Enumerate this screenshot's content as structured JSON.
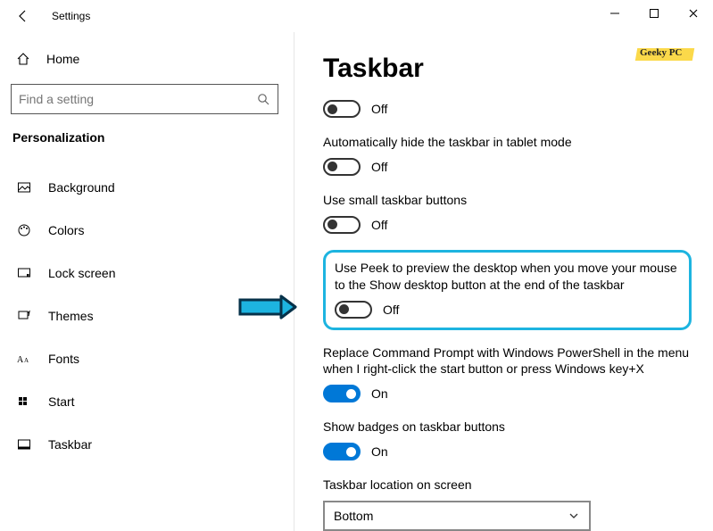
{
  "app_title": "Settings",
  "home_label": "Home",
  "search_placeholder": "Find a setting",
  "category": "Personalization",
  "nav": {
    "items": [
      {
        "label": "Background"
      },
      {
        "label": "Colors"
      },
      {
        "label": "Lock screen"
      },
      {
        "label": "Themes"
      },
      {
        "label": "Fonts"
      },
      {
        "label": "Start"
      },
      {
        "label": "Taskbar"
      }
    ]
  },
  "page_title": "Taskbar",
  "badge_text": "Geeky PC",
  "settings": {
    "s0_state": "Off",
    "s1_label": "Automatically hide the taskbar in tablet mode",
    "s1_state": "Off",
    "s2_label": "Use small taskbar buttons",
    "s2_state": "Off",
    "s3_label": "Use Peek to preview the desktop when you move your mouse to the Show desktop button at the end of the taskbar",
    "s3_state": "Off",
    "s4_label": "Replace Command Prompt with Windows PowerShell in the menu when I right-click the start button or press Windows key+X",
    "s4_state": "On",
    "s5_label": "Show badges on taskbar buttons",
    "s5_state": "On",
    "s6_label": "Taskbar location on screen",
    "s6_value": "Bottom"
  }
}
